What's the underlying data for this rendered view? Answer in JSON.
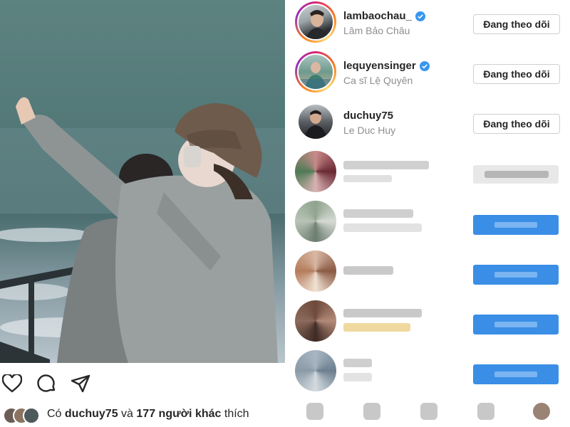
{
  "post": {
    "photo_name": "post-photo",
    "likes": {
      "prefix": "Có",
      "user": "duchuy75",
      "middle": "và",
      "others": "177 người khác",
      "suffix": "thích"
    }
  },
  "follow_list": [
    {
      "username": "lambaochau_",
      "full_name": "Lâm Bảo Châu",
      "verified": true,
      "button": "Đang theo dõi",
      "story_ring": true
    },
    {
      "username": "lequyensinger",
      "full_name": "Ca sĩ Lệ Quyên",
      "verified": true,
      "button": "Đang theo dõi",
      "story_ring": true
    },
    {
      "username": "duchuy75",
      "full_name": "Le Duc Huy",
      "verified": false,
      "button": "Đang theo dõi",
      "story_ring": false
    }
  ],
  "colors": {
    "follow_blue": "#3a8ee6",
    "verified_blue": "#3897f0",
    "text_primary": "#262626",
    "text_secondary": "#8e8e8e"
  },
  "icons": [
    "heart-icon",
    "comment-icon",
    "share-icon",
    "verified-badge-icon"
  ]
}
